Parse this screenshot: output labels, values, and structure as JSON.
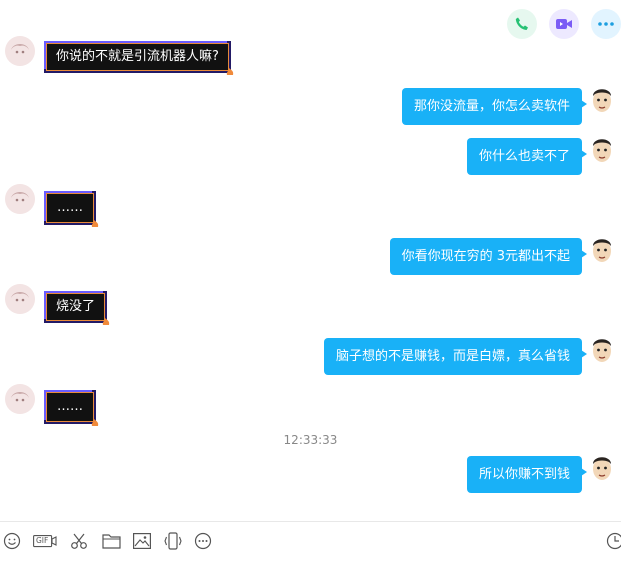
{
  "header": {
    "actions": [
      {
        "icon": "phone-icon",
        "color": "#27c174"
      },
      {
        "icon": "video-icon",
        "color": "#7b5cf5"
      },
      {
        "icon": "more-icon",
        "color": "#1e9fe0"
      }
    ]
  },
  "messages": [
    {
      "side": "left",
      "text": "你说的不就是引流机器人嘛?"
    },
    {
      "side": "right",
      "text": "那你没流量，你怎么卖软件"
    },
    {
      "side": "right",
      "text": "你什么也卖不了"
    },
    {
      "side": "left",
      "text": "……"
    },
    {
      "side": "right",
      "text": "你看你现在穷的 3元都出不起"
    },
    {
      "side": "left",
      "text": "烧没了"
    },
    {
      "side": "right",
      "text": "脑子想的不是赚钱，而是白嫖，真么省钱"
    },
    {
      "side": "left",
      "text": "……"
    },
    {
      "side": "right",
      "text": "所以你赚不到钱"
    }
  ],
  "timestamp": "12:33:33",
  "toolbar": {
    "tools": [
      "emoji-icon",
      "gif-icon",
      "scissors-icon",
      "folder-icon",
      "image-icon",
      "shake-icon",
      "more-circle-icon",
      "history-icon"
    ],
    "gif_label": "GIF"
  },
  "colors": {
    "bubble_right": "#19b1f7",
    "bubble_left": "#111111"
  }
}
